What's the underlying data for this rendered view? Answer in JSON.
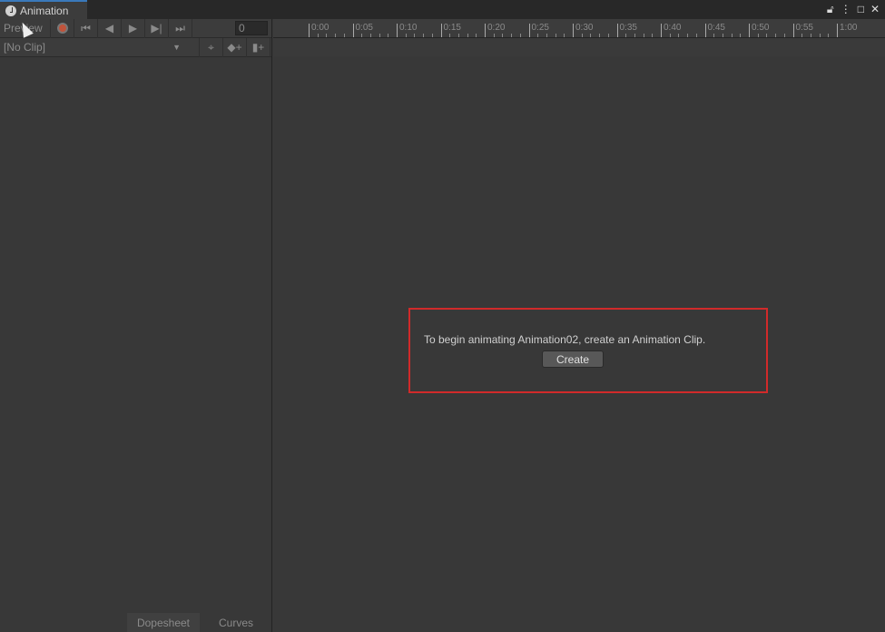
{
  "window": {
    "tab_title": "Animation",
    "icons": [
      "lock-icon",
      "more-icon",
      "maximize-icon",
      "close-icon"
    ]
  },
  "toolbar": {
    "preview_label": "Preview",
    "frame_value": "0"
  },
  "clip": {
    "selected": "[No Clip]"
  },
  "ruler": {
    "labels": [
      "0:00",
      "0:05",
      "0:10",
      "0:15",
      "0:20",
      "0:25",
      "0:30",
      "0:35",
      "0:40",
      "0:45",
      "0:50",
      "0:55",
      "1:00"
    ]
  },
  "bottom_tabs": {
    "dopesheet": "Dopesheet",
    "curves": "Curves"
  },
  "empty_state": {
    "message": "To begin animating Animation02, create an Animation Clip.",
    "create_label": "Create"
  }
}
